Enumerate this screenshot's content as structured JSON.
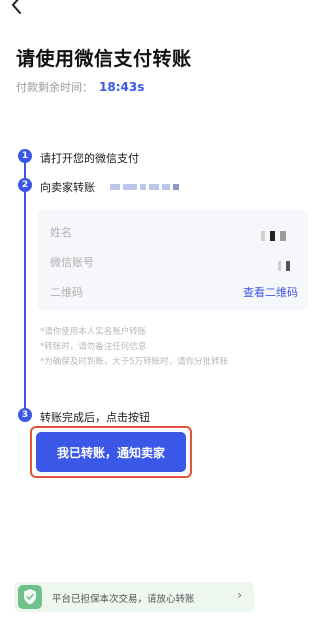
{
  "page": {
    "title": "请使用微信支付转账",
    "timer_label": "付款剩余时间：",
    "timer_value": "18:43s"
  },
  "steps": [
    {
      "number": "1",
      "label": "请打开您的微信支付"
    },
    {
      "number": "2",
      "label": "向卖家转账"
    },
    {
      "number": "3",
      "label": "转账完成后，点击按钮"
    }
  ],
  "info_card": {
    "name_label": "姓名",
    "wechat_id_label": "微信账号",
    "qr_label": "二维码",
    "qr_link": "查看二维码"
  },
  "notes": [
    "*请你使用本人实名账户转账",
    "*转账时，请勿备注任何信息",
    "*为确保及时到账，大于5万转账时，请你分批转账"
  ],
  "cta": {
    "label": "我已转账，通知卖家"
  },
  "bottom_bar": {
    "text": "平台已担保本次交易，请放心转账"
  },
  "colors": {
    "accent": "#3b57e8",
    "highlight": "#e1533b",
    "guarantee_bg": "#eef6f0"
  }
}
